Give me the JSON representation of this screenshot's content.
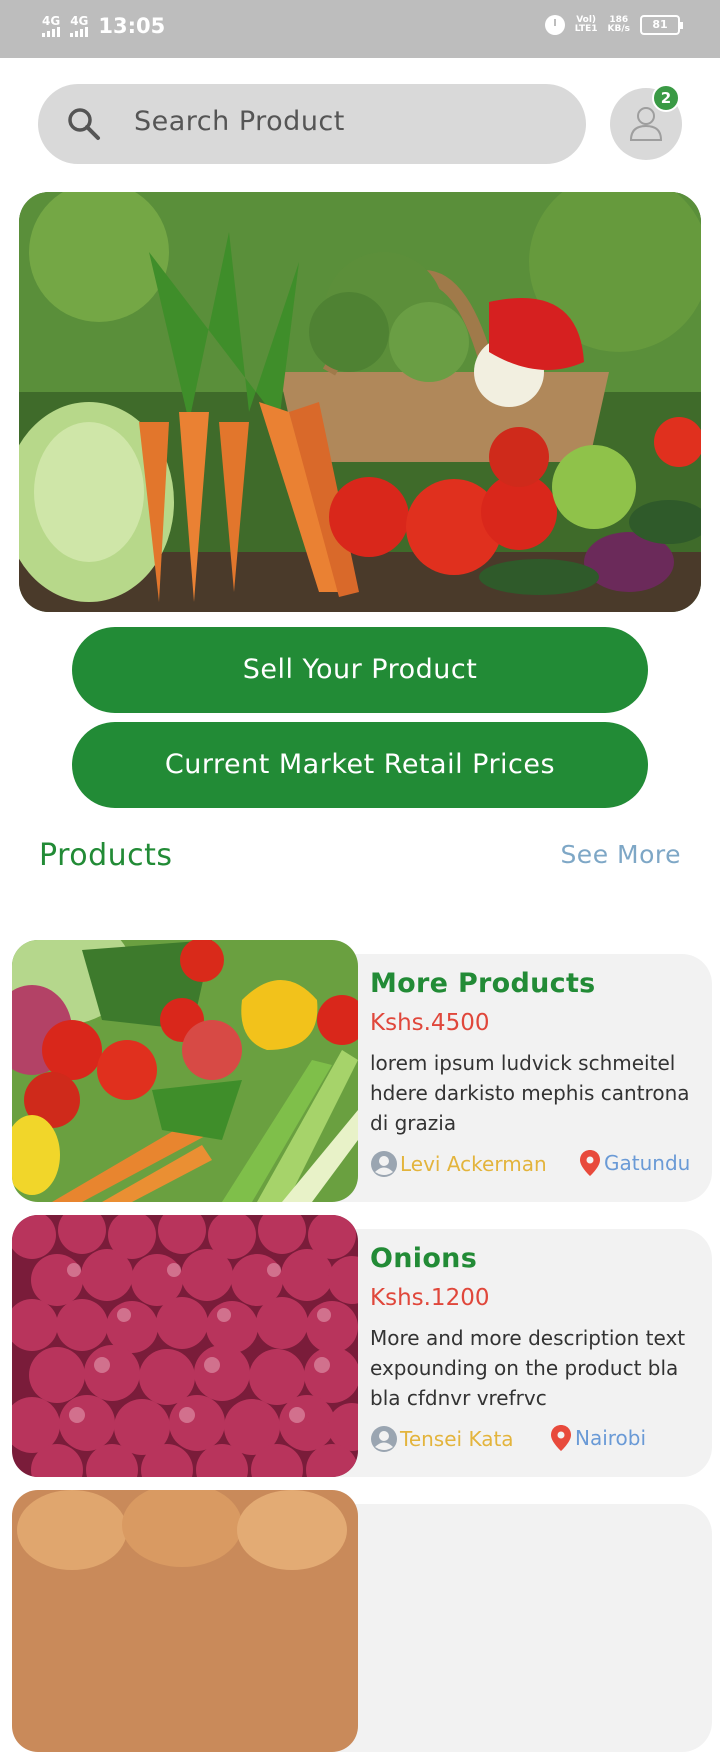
{
  "status_bar": {
    "network1": "4G",
    "network2": "4G",
    "time": "13:05",
    "volte": "Vol)",
    "lte": "LTE1",
    "speed": "186",
    "speed_unit": "KB/s",
    "battery": "81"
  },
  "search": {
    "placeholder": "Search Product",
    "icon": "search-icon"
  },
  "profile": {
    "icon": "user-icon",
    "badge_count": "2"
  },
  "buttons": {
    "sell": "Sell Your Product",
    "prices": "Current Market Retail Prices"
  },
  "products_section": {
    "title": "Products",
    "see_more": "See More"
  },
  "products": [
    {
      "title": "More Products",
      "price": "Kshs.4500",
      "description": "lorem ipsum ludvick schmeitel hdere darkisto mephis cantrona di grazia",
      "seller": "Levi Ackerman",
      "location": "Gatundu"
    },
    {
      "title": "Onions",
      "price": "Kshs.1200",
      "description": "More and more description text expounding on the product bla bla cfdnvr vrefrvc",
      "seller": "Tensei Kata",
      "location": "Nairobi"
    }
  ],
  "colors": {
    "primary_green": "#228b36",
    "price_red": "#e0473b",
    "seller_gold": "#e3b43c",
    "location_blue": "#6a9ad6",
    "link_blue": "#7ea7c6"
  }
}
